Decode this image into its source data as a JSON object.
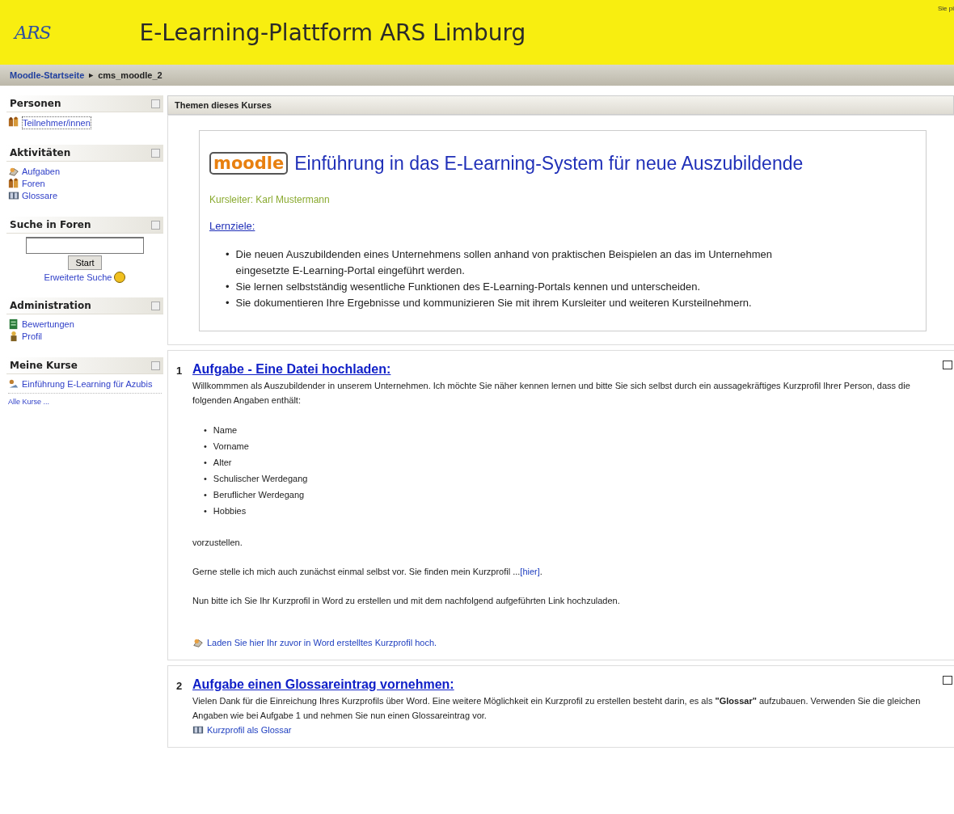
{
  "header": {
    "logo": "ARS",
    "title": "E-Learning-Plattform ARS Limburg",
    "corner": "Sie pi"
  },
  "breadcrumb": {
    "home": "Moodle-Startseite",
    "separator": "►",
    "current": "cms_moodle_2"
  },
  "sidebar": [
    {
      "title": "Personen",
      "items": [
        {
          "label": "Teilnehmer/innen",
          "kind": "people"
        }
      ]
    },
    {
      "title": "Aktivitäten",
      "items": [
        {
          "label": "Aufgaben",
          "kind": "task"
        },
        {
          "label": "Foren",
          "kind": "people"
        },
        {
          "label": "Glossare",
          "kind": "book"
        }
      ]
    },
    {
      "title": "Suche in Foren",
      "search": {
        "button": "Start",
        "advanced": "Erweiterte Suche"
      }
    },
    {
      "title": "Administration",
      "items": [
        {
          "label": "Bewertungen",
          "kind": "grades"
        },
        {
          "label": "Profil",
          "kind": "person"
        }
      ]
    },
    {
      "title": "Meine Kurse",
      "items": [
        {
          "label": "Einführung E-Learning für Azubis",
          "kind": "course"
        }
      ],
      "footer": "Alle Kurse ..."
    }
  ],
  "main": {
    "heading": "Themen dieses Kurses",
    "intro": {
      "logo": "moodle",
      "title": "Einführung in das E-Learning-System für neue Auszubildende",
      "teacher": "Kursleiter: Karl Mustermann",
      "goals_link": "Lernziele:",
      "bullet": "•",
      "goals": [
        "Die neuen Auszubildenden eines Unternehmens sollen anhand von praktischen Beispielen an das im Unternehmen eingesetzte E-Learning-Portal eingeführt werden.",
        "Sie lernen selbstständig wesentliche Funktionen des E-Learning-Portals kennen und unterscheiden.",
        "Sie dokumentieren Ihre Ergebnisse und kommunizieren Sie mit ihrem Kursleiter und weiteren Kursteilnehmern."
      ]
    },
    "sections": [
      {
        "number": "1",
        "title": "Aufgabe - Eine Datei hochladen:",
        "blocks": [
          {
            "kind": "text",
            "text": "Willkommmen als Auszubildender in unserem Unternehmen. Ich möchte Sie näher kennen lernen und bitte Sie sich selbst durch ein aussagekräftiges Kurzprofil Ihrer Person, dass die folgenden Angaben enthält:"
          },
          {
            "kind": "list",
            "bullet": "•",
            "items": [
              "Name",
              "Vorname",
              "Alter",
              "Schulischer Werdegang",
              "Beruflicher Werdegang",
              "Hobbies"
            ]
          },
          {
            "kind": "text",
            "text": "vorzustellen."
          },
          {
            "kind": "linktext",
            "before": "Gerne stelle ich mich auch zunächst einmal selbst vor. Sie finden mein Kurzprofil ...",
            "link": "[hier]",
            "after": "."
          },
          {
            "kind": "text",
            "text": "Nun bitte ich Sie Ihr Kurzprofil in Word zu erstellen und mit dem nachfolgend aufgeführten Link hochzuladen."
          },
          {
            "kind": "assignment",
            "text": "Laden Sie hier Ihr zuvor in Word erstelltes Kurzprofil hoch."
          }
        ]
      },
      {
        "number": "2",
        "title": "Aufgabe einen Glossareintrag vornehmen:",
        "blocks": [
          {
            "kind": "tight",
            "text": "Vielen Dank für die Einreichung Ihres Kurzprofils über Word. Eine weitere Möglichkeit ein Kurzprofil zu erstellen besteht darin, es als **\"Glossar\"** aufzubauen. Verwenden Sie die gleichen Angaben wie bei Aufgabe 1 und nehmen Sie nun einen Glossareintrag vor."
          },
          {
            "kind": "glossary",
            "text": "Kurzprofil als Glossar"
          }
        ]
      }
    ]
  }
}
